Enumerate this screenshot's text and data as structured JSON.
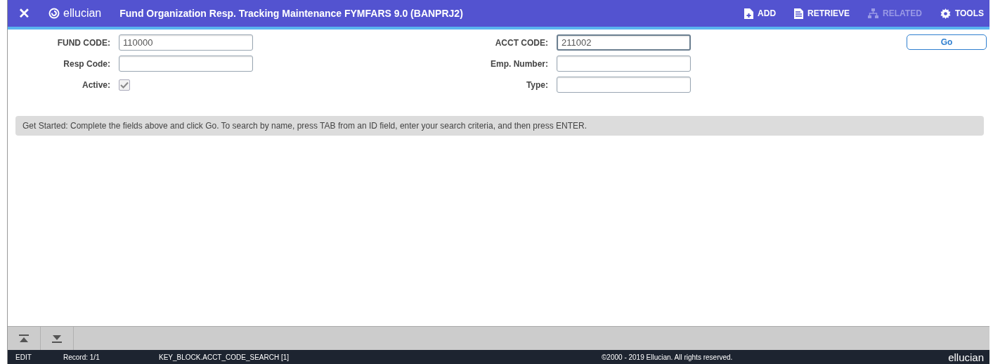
{
  "header": {
    "close": "✕",
    "logo": "ellucian",
    "title": "Fund Organization Resp. Tracking Maintenance FYMFARS 9.0 (BANPRJ2)",
    "actions": [
      {
        "label": "ADD",
        "kind": "add",
        "disabled": false
      },
      {
        "label": "RETRIEVE",
        "kind": "retrieve",
        "disabled": false
      },
      {
        "label": "RELATED",
        "kind": "related",
        "disabled": true
      },
      {
        "label": "TOOLS",
        "kind": "tools",
        "disabled": false
      }
    ]
  },
  "form": {
    "rows": [
      [
        {
          "kind": "field",
          "label": "FUND CODE:",
          "value": "110000",
          "focused": false
        },
        {
          "kind": "field",
          "label": "ACCT CODE:",
          "value": "211002",
          "focused": true
        }
      ],
      [
        {
          "kind": "field",
          "label": "Resp Code:",
          "focused": false
        },
        {
          "kind": "field",
          "label": "Emp. Number:",
          "focused": false
        }
      ],
      [
        {
          "kind": "checkbox",
          "label": "Active:",
          "checked": true
        },
        {
          "kind": "field",
          "label": "Type:",
          "focused": false
        }
      ]
    ],
    "go_button": "Go"
  },
  "message": "Get Started: Complete the fields above and click Go. To search by name, press TAB from an ID field, enter your search criteria, and then press ENTER.",
  "status_bar": {
    "mode": "EDIT",
    "record": "Record: 1/1",
    "block": "KEY_BLOCK.ACCT_CODE_SEARCH [1]",
    "copyright": "©2000 - 2019 Ellucian. All rights reserved.",
    "brand": "ellucian"
  }
}
